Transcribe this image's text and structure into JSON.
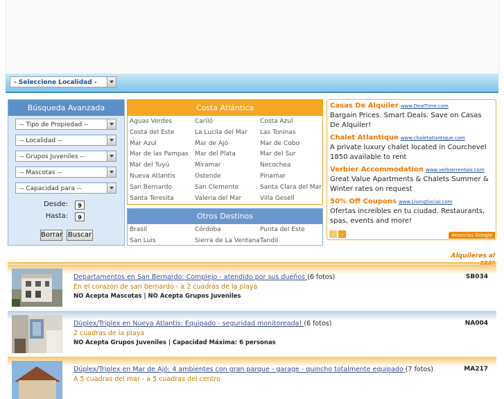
{
  "location_bar": {
    "select_value": "- Seleccione Localidad -"
  },
  "search": {
    "title": "Búsqueda Avanzada",
    "filters": [
      "-- Tipo de Propiedad --",
      "-- Localidad --",
      "-- Grupos Juveniles --",
      "-- Mascotas --",
      "-- Capacidad para --"
    ],
    "desde_label": "Desde:",
    "hasta_label": "Hasta:",
    "calendar_glyph": "9",
    "clear_button": "Borrar",
    "search_button": "Buscar"
  },
  "costa": {
    "title": "Costa Atlántica",
    "items": [
      "Aguas Verdes",
      "Cariló",
      "Costa Azul",
      "Costa del Este",
      "La Lucila del Mar",
      "Las Toninas",
      "Mar Azul",
      "Mar de Ajó",
      "Mar de Cobo",
      "Mar de las Pampas",
      "Mar del Plata",
      "Mar del Sur",
      "Mar del Tuyú",
      "Miramar",
      "Necochea",
      "Nueva Atlantis",
      "Ostende",
      "Pinamar",
      "San Bernardo",
      "San Clemente",
      "Santa Clara del Mar",
      "Santa Teresita",
      "Valeria del Mar",
      "Villa Gesell"
    ]
  },
  "otros": {
    "title": "Otros Destinos",
    "items": [
      "Brasil",
      "Córdoba",
      "Punta del Este",
      "San Luis",
      "Sierra de La Ventana",
      "Tandil"
    ]
  },
  "ads": {
    "items": [
      {
        "title": "Casas De Alquiler",
        "url": "www.DealTime.com",
        "desc": "Bargain Prices. Smart Deals. Save on Casas De Alquiler!"
      },
      {
        "title": "Chalet Atlantique",
        "url": "www.chaletatlantique.com",
        "desc": "A private luxury chalet located in Courchevel 1850 available to rent"
      },
      {
        "title": "Verbier Accommodation",
        "url": "www.verbierrentals.com",
        "desc": "Great Value Apartments & Chalets Summer & Winter rates on request"
      },
      {
        "title": "50% Off Coupons",
        "url": "www.LivingSocial.com",
        "desc": "Ofertas increíbles en tu ciudad. Restaurants, spas, events and more!"
      }
    ],
    "prev_glyph": "‹",
    "next_glyph": "›",
    "badge": "Anuncios Google"
  },
  "random_heading": "Alquileres al azar",
  "listings": [
    {
      "title": "Departamentos en San Bernardo: Complejo - atendido por sus dueños",
      "photos": "(6 fotos)",
      "code": "SB034",
      "subtitle": "En el corazon de san bernardo - a 2 cuadras de la playa",
      "features": "NO Acepta Mascotas | NO Acepta Grupos Juveniles"
    },
    {
      "title": "Dúplex/Triplex en Nueva Atlantis: Equipado - seguridad monitoreada!",
      "photos": "(6 fotos)",
      "code": "NA004",
      "subtitle": "2 cuadras de la playa",
      "features": "NO Acepta Grupos Juveniles | Capacidad Máxima: 6 personas"
    },
    {
      "title": "Dúplex/Triplex en Mar de Ajó: 4 ambientes con gran parque - garage - quincho totalmente equipado",
      "photos": "(7 fotos)",
      "code": "MA217",
      "subtitle": "A 5 cuadras del mar - a 5 cuadras del centro",
      "features": ""
    }
  ]
}
